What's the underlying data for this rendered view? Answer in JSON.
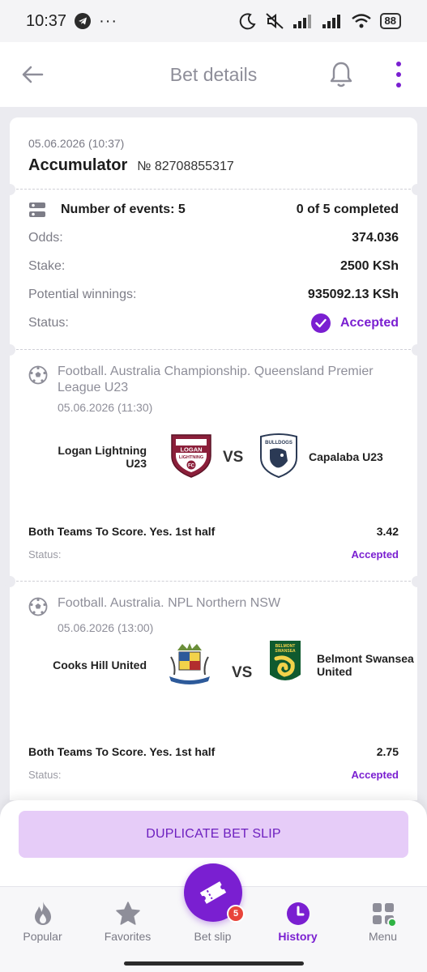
{
  "status_bar": {
    "time": "10:37",
    "more": "···",
    "battery": "88"
  },
  "header": {
    "title": "Bet details"
  },
  "bet": {
    "date": "05.06.2026 (10:37)",
    "type": "Accumulator",
    "number": "№ 82708855317",
    "events_label": "Number of events: 5",
    "completed": "0 of 5 completed",
    "odds_label": "Odds:",
    "odds": "374.036",
    "stake_label": "Stake:",
    "stake": "2500 KSh",
    "winnings_label": "Potential winnings:",
    "winnings": "935092.13 KSh",
    "status_label": "Status:",
    "status": "Accepted"
  },
  "events": [
    {
      "league": "Football. Australia Championship. Queensland Premier League U23",
      "date": "05.06.2026 (11:30)",
      "home": "Logan Lightning U23",
      "away": "Capalaba U23",
      "vs": "VS",
      "market": "Both Teams To Score. Yes. 1st half",
      "odds": "3.42",
      "status_label": "Status:",
      "status": "Accepted",
      "home_logo_text": [
        "LOGAN",
        "LIGHTNING",
        "FC"
      ],
      "away_logo_text": "BULLDOGS"
    },
    {
      "league": "Football. Australia. NPL Northern NSW",
      "date": "05.06.2026 (13:00)",
      "home": "Cooks Hill United",
      "away": "Belmont Swansea United",
      "vs": "VS",
      "market": "Both Teams To Score. Yes. 1st half",
      "odds": "2.75",
      "status_label": "Status:",
      "status": "Accepted",
      "away_logo_text": [
        "BELMONT",
        "SWANSEA"
      ]
    }
  ],
  "actions": {
    "duplicate": "DUPLICATE BET SLIP"
  },
  "nav": {
    "items": [
      "Popular",
      "Favorites",
      "Bet slip",
      "History",
      "Menu"
    ],
    "active": "History",
    "betslip_count": "5"
  },
  "colors": {
    "accent": "#7a1fd1",
    "accent_light": "#e6ccf8",
    "badge": "#e8443a"
  }
}
